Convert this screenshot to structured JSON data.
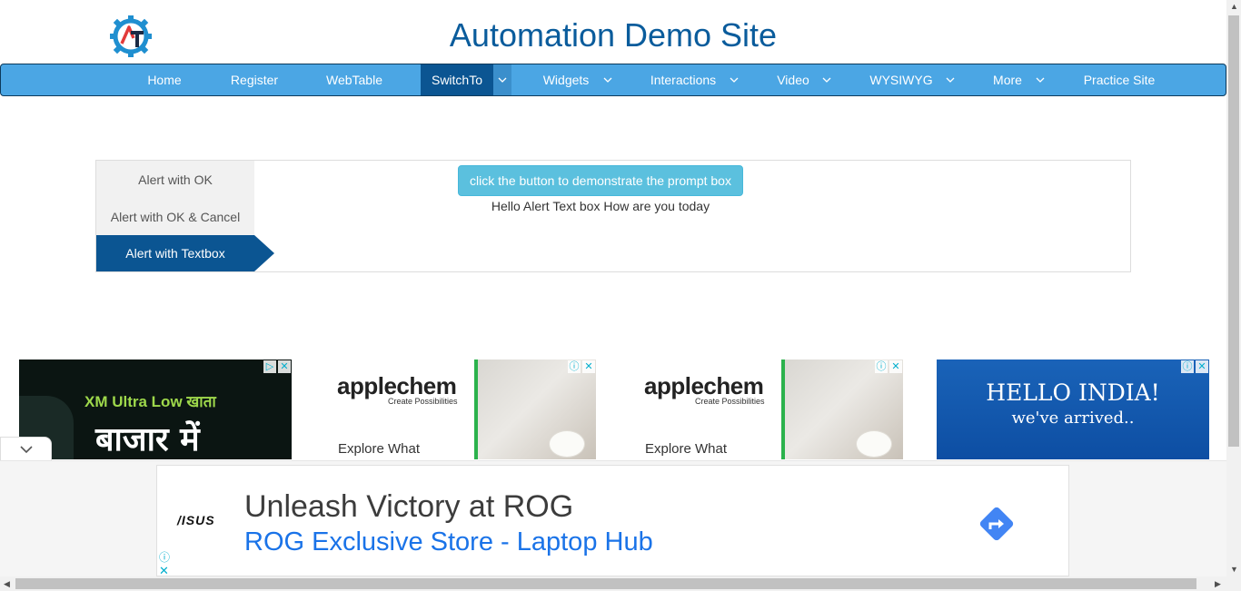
{
  "header": {
    "title": "Automation Demo Site",
    "logo_icon": "gear-logo-icon"
  },
  "nav": {
    "items": [
      {
        "label": "Home",
        "has_caret": false,
        "active": false
      },
      {
        "label": "Register",
        "has_caret": false,
        "active": false
      },
      {
        "label": "WebTable",
        "has_caret": false,
        "active": false
      },
      {
        "label": "SwitchTo",
        "has_caret": true,
        "active": true
      },
      {
        "label": "Widgets",
        "has_caret": true,
        "active": false
      },
      {
        "label": "Interactions",
        "has_caret": true,
        "active": false
      },
      {
        "label": "Video",
        "has_caret": true,
        "active": false
      },
      {
        "label": "WYSIWYG",
        "has_caret": true,
        "active": false
      },
      {
        "label": "More",
        "has_caret": true,
        "active": false
      },
      {
        "label": "Practice Site",
        "has_caret": false,
        "active": false
      }
    ]
  },
  "alerts": {
    "tabs": [
      {
        "label": "Alert with OK",
        "active": false
      },
      {
        "label": "Alert with OK & Cancel",
        "active": false
      },
      {
        "label": "Alert with Textbox",
        "active": true
      }
    ],
    "button_label": "click the button to demonstrate the prompt box",
    "result_text": "Hello Alert Text box How are you today"
  },
  "ads": [
    {
      "line1": "XM Ultra Low खाता",
      "line2": "बाजार में"
    },
    {
      "brand": "applechem",
      "tagline": "Create Possibilities",
      "cta": "Explore What"
    },
    {
      "brand": "applechem",
      "tagline": "Create Possibilities",
      "cta": "Explore What"
    },
    {
      "line1": "HELLO INDIA!",
      "line2": "we've arrived.."
    }
  ],
  "bottom_banner": {
    "brand": "/ISUS",
    "headline": "Unleash Victory at ROG",
    "subline": "ROG Exclusive Store - Laptop Hub",
    "info_glyph": "ⓘ",
    "close_glyph": "✕"
  },
  "colors": {
    "nav_bg": "#4ba6e4",
    "nav_active": "#0b5592",
    "title": "#0a5c9c",
    "button": "#5bc0de",
    "link_blue": "#1a73e8"
  }
}
